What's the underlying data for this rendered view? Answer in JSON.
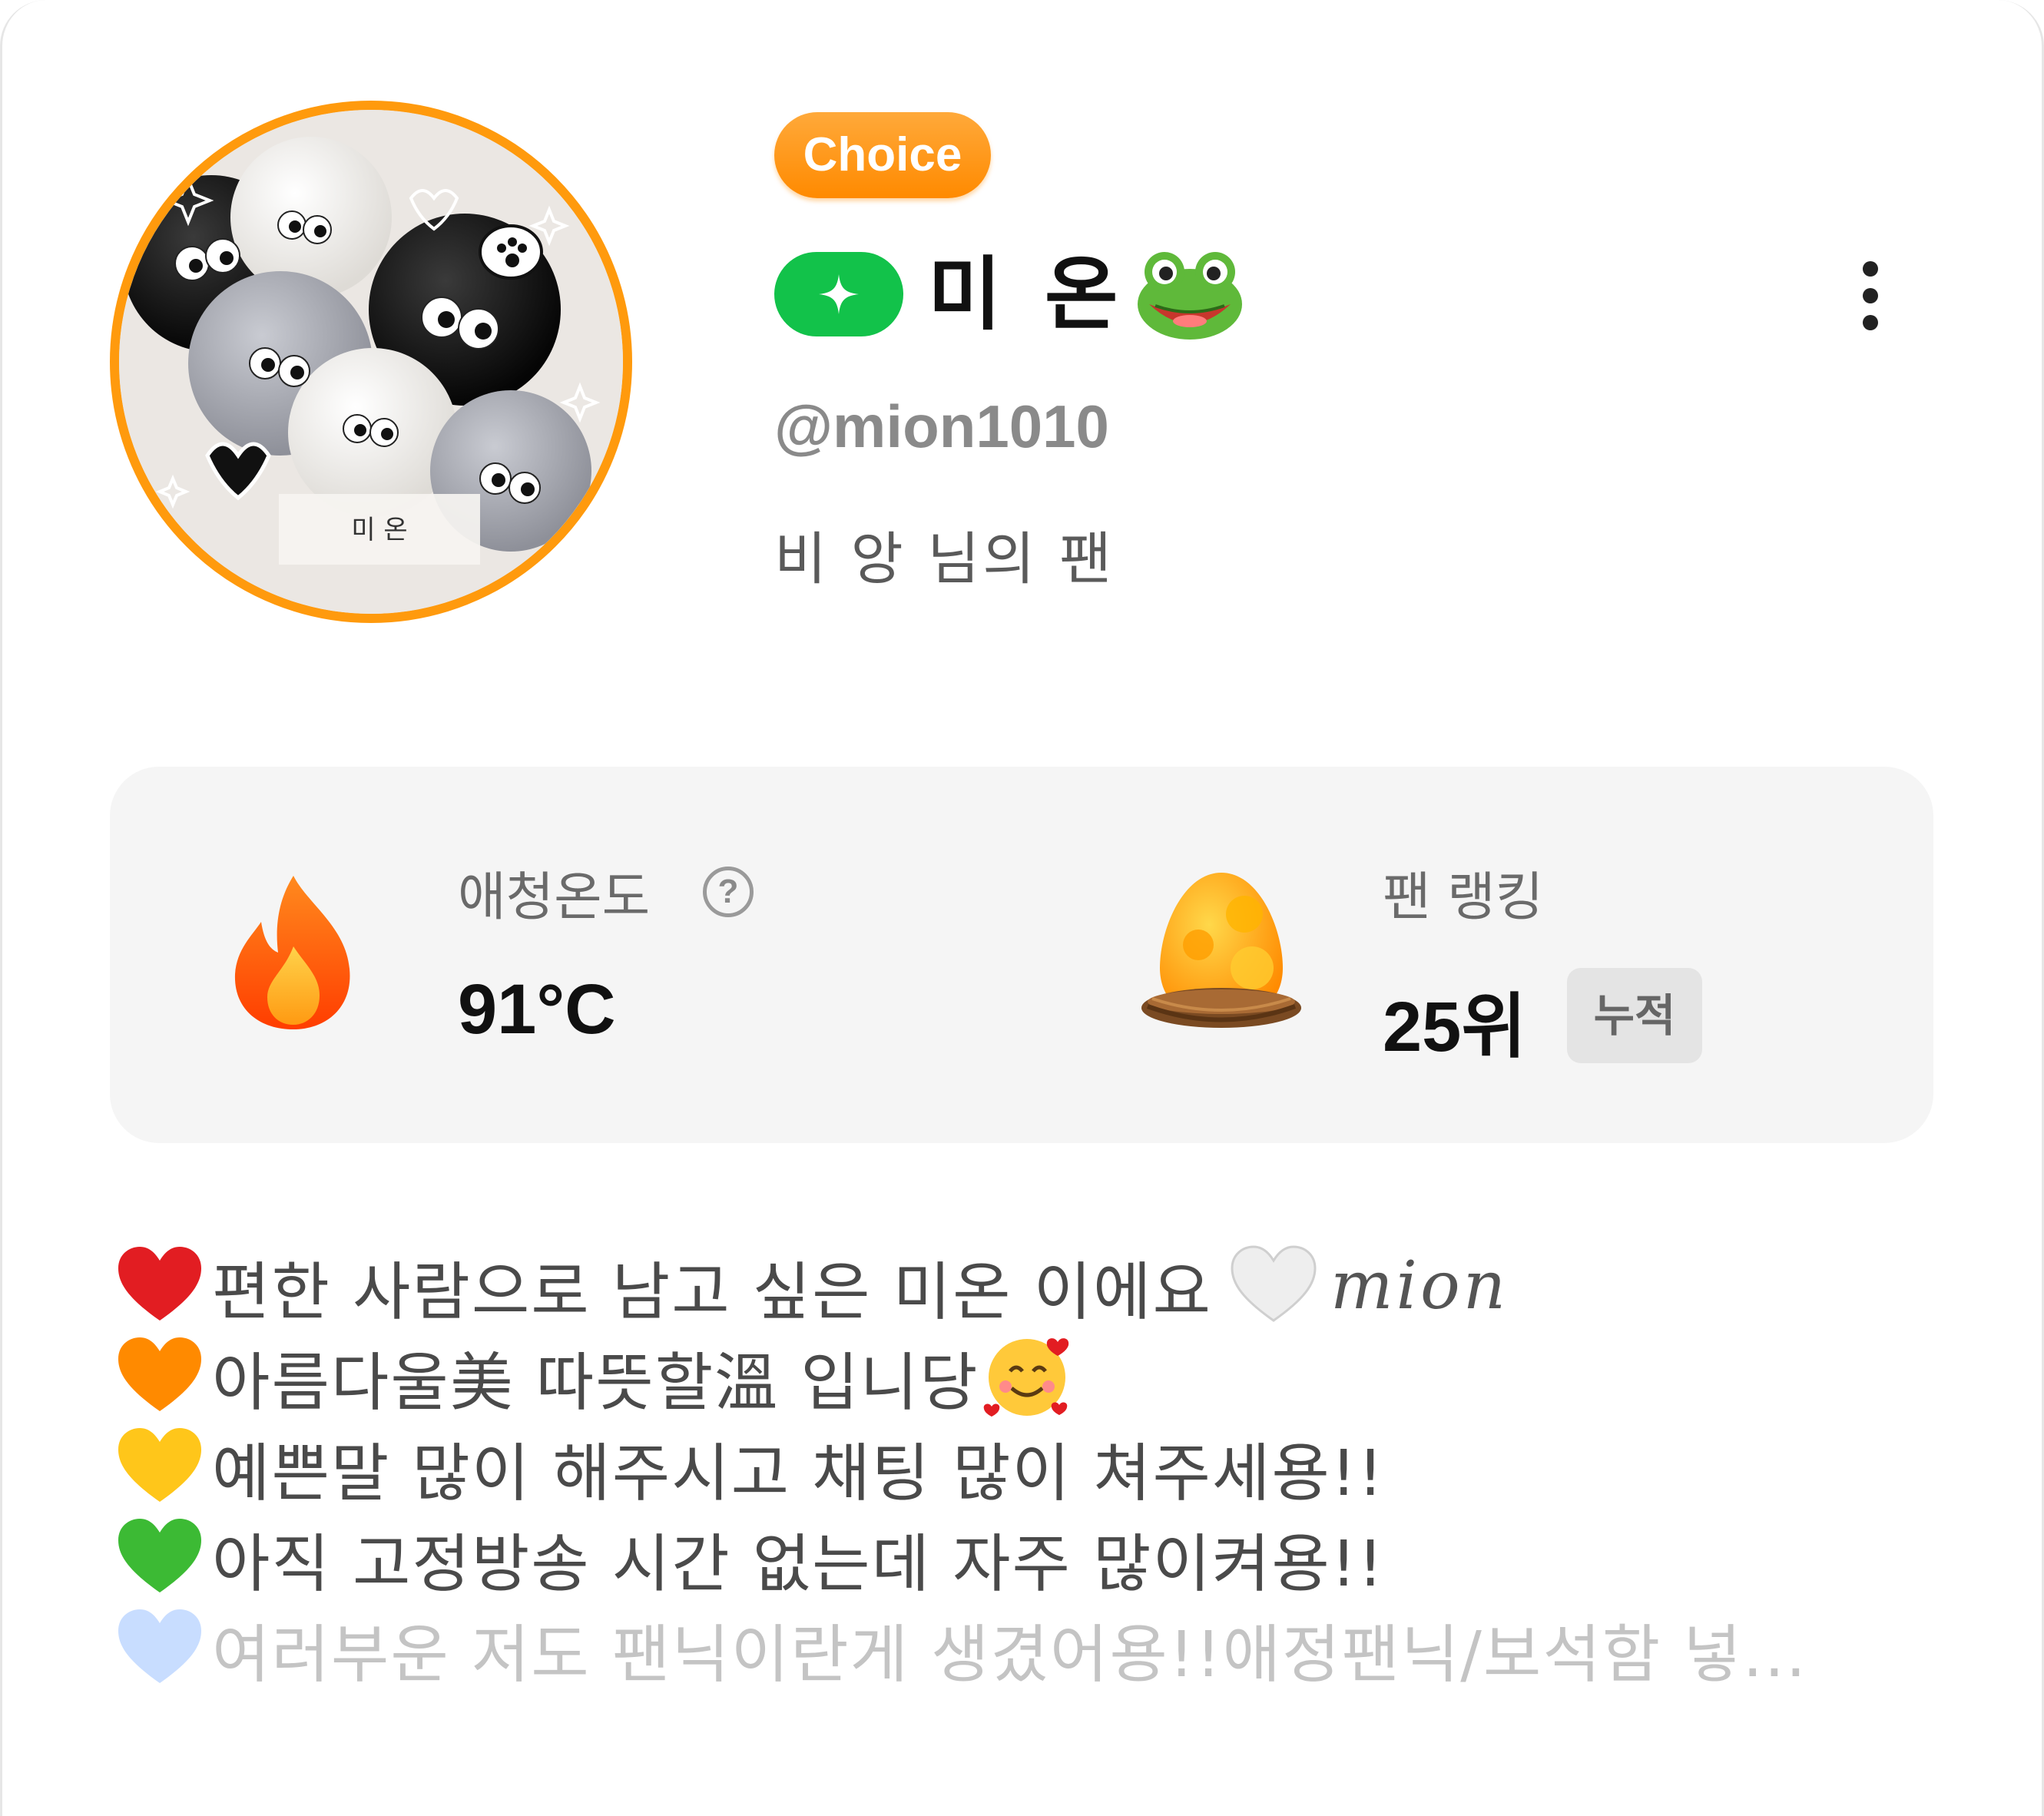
{
  "profile": {
    "avatar_caption": "미 온",
    "badge": "Choice",
    "display_name": "미 온",
    "handle": "@mion1010",
    "fan_of": "비 앙 님의 팬"
  },
  "stats": {
    "temperature": {
      "label": "애청온도",
      "help": "?",
      "value": "91°C"
    },
    "ranking": {
      "label": "팬 랭킹",
      "value": "25위",
      "tag": "누적"
    }
  },
  "bio": {
    "lines": [
      "편한 사람으로 남고 싶은 미온 이에요",
      "아름다울美 따뜻할溫 입니당",
      "예쁜말 많이 해주시고 채팅 많이 쳐주세용!!",
      "아직 고정방송 시간 없는데 자주 많이켜용!!",
      "여러부운 저도 팬닉이란게 생겼어용!!애정팬닉/보석함 넣..."
    ],
    "signature": "mion"
  },
  "icons": {
    "badge_plus": "sparkle-plus-icon",
    "more": "more-vertical-icon",
    "temperature": "flame-icon",
    "ranking": "egg-nest-icon",
    "hearts": [
      "red-heart-icon",
      "orange-heart-icon",
      "yellow-heart-icon",
      "green-heart-icon",
      "blue-heart-icon"
    ]
  },
  "colors": {
    "accent_orange": "#ff9a0d",
    "badge_green": "#12c24a",
    "card_bg": "#f5f5f5"
  }
}
